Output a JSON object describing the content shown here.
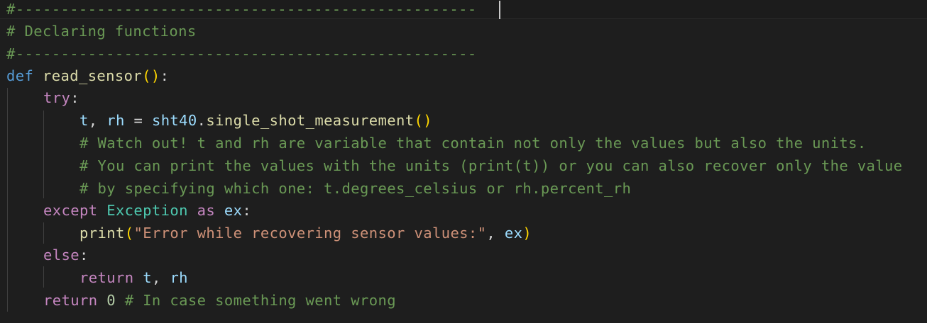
{
  "editor": {
    "lines": [
      {
        "tokens": [
          {
            "t": "#---------------------------------------------------",
            "c": "cm"
          }
        ]
      },
      {
        "tokens": [
          {
            "t": "# Declaring functions",
            "c": "cm"
          }
        ]
      },
      {
        "tokens": [
          {
            "t": "#---------------------------------------------------",
            "c": "cm"
          }
        ]
      },
      {
        "tokens": [
          {
            "t": "def",
            "c": "kw"
          },
          {
            "t": " ",
            "c": "pl"
          },
          {
            "t": "read_sensor",
            "c": "fn"
          },
          {
            "t": "()",
            "c": "br"
          },
          {
            "t": ":",
            "c": "pl"
          }
        ]
      },
      {
        "tokens": [
          {
            "t": "try",
            "c": "ctl"
          },
          {
            "t": ":",
            "c": "pl"
          }
        ]
      },
      {
        "tokens": [
          {
            "t": "t",
            "c": "var"
          },
          {
            "t": ", ",
            "c": "pl"
          },
          {
            "t": "rh",
            "c": "var"
          },
          {
            "t": " = ",
            "c": "pl"
          },
          {
            "t": "sht40",
            "c": "var"
          },
          {
            "t": ".",
            "c": "pl"
          },
          {
            "t": "single_shot_measurement",
            "c": "fn"
          },
          {
            "t": "()",
            "c": "br"
          }
        ]
      },
      {
        "tokens": [
          {
            "t": "# Watch out! t and rh are variable that contain not only the values but also the units.",
            "c": "cm"
          }
        ]
      },
      {
        "tokens": [
          {
            "t": "# You can print the values with the units (print(t)) or you can also recover only the value",
            "c": "cm"
          }
        ]
      },
      {
        "tokens": [
          {
            "t": "# by specifying which one: t.degrees_celsius or rh.percent_rh",
            "c": "cm"
          }
        ]
      },
      {
        "tokens": [
          {
            "t": "except",
            "c": "ctl"
          },
          {
            "t": " ",
            "c": "pl"
          },
          {
            "t": "Exception",
            "c": "cls"
          },
          {
            "t": " ",
            "c": "pl"
          },
          {
            "t": "as",
            "c": "ctl"
          },
          {
            "t": " ",
            "c": "pl"
          },
          {
            "t": "ex",
            "c": "var"
          },
          {
            "t": ":",
            "c": "pl"
          }
        ]
      },
      {
        "tokens": [
          {
            "t": "print",
            "c": "fn"
          },
          {
            "t": "(",
            "c": "br"
          },
          {
            "t": "\"Error while recovering sensor values:\"",
            "c": "str"
          },
          {
            "t": ", ",
            "c": "pl"
          },
          {
            "t": "ex",
            "c": "var"
          },
          {
            "t": ")",
            "c": "br"
          }
        ]
      },
      {
        "tokens": [
          {
            "t": "else",
            "c": "ctl"
          },
          {
            "t": ":",
            "c": "pl"
          }
        ]
      },
      {
        "tokens": [
          {
            "t": "return",
            "c": "ctl"
          },
          {
            "t": " ",
            "c": "pl"
          },
          {
            "t": "t",
            "c": "var"
          },
          {
            "t": ", ",
            "c": "pl"
          },
          {
            "t": "rh",
            "c": "var"
          }
        ]
      },
      {
        "tokens": [
          {
            "t": "return",
            "c": "ctl"
          },
          {
            "t": " ",
            "c": "pl"
          },
          {
            "t": "0",
            "c": "num"
          },
          {
            "t": " ",
            "c": "pl"
          },
          {
            "t": "# In case something went wrong",
            "c": "cm"
          }
        ]
      }
    ]
  }
}
